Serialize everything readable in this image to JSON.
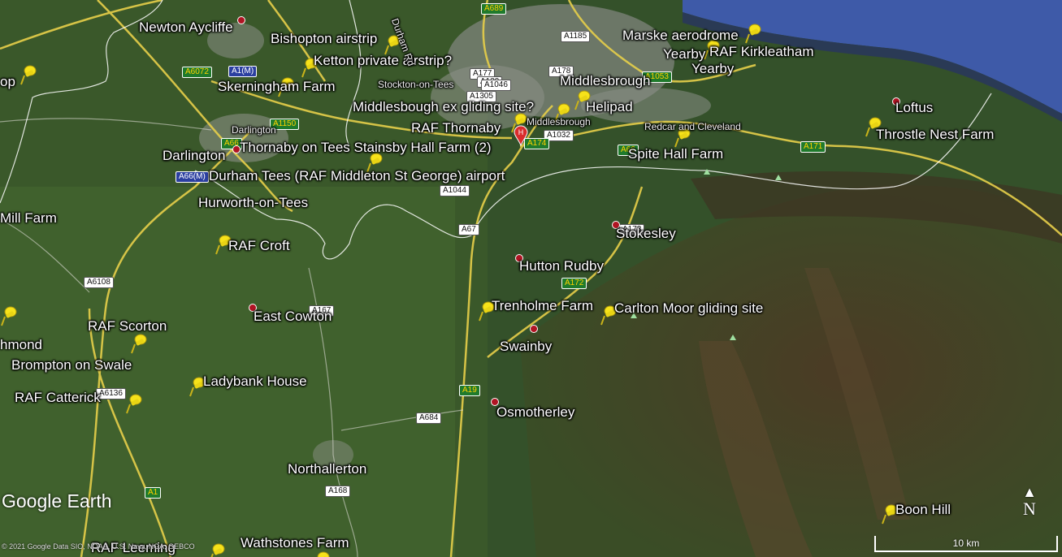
{
  "map": {
    "place_labels": [
      {
        "id": "newton-aycliffe",
        "text": "Newton Aycliffe"
      },
      {
        "id": "bishopton-airstrip",
        "text": "Bishopton airstrip"
      },
      {
        "id": "ketton-private-airstrip",
        "text": "Ketton private airstrip?"
      },
      {
        "id": "skerningham-farm",
        "text": "Skerningham Farm"
      },
      {
        "id": "stockton-on-tees",
        "text": "Stockton-on-Tees"
      },
      {
        "id": "middlesbrough",
        "text": "Middlesbrough"
      },
      {
        "id": "marske-aerodrome",
        "text": "Marske aerodrome"
      },
      {
        "id": "yearby-1",
        "text": "Yearby"
      },
      {
        "id": "raf-kirkleatham",
        "text": "RAF Kirkleatham"
      },
      {
        "id": "yearby-2",
        "text": "Yearby"
      },
      {
        "id": "middlesbough-ex-gliding-site",
        "text": "Middlesbough ex gliding site?"
      },
      {
        "id": "helipad",
        "text": "Helipad"
      },
      {
        "id": "loftus",
        "text": "Loftus"
      },
      {
        "id": "throstle-nest-farm",
        "text": "Throstle Nest Farm"
      },
      {
        "id": "raf-thornaby",
        "text": "RAF Thornaby"
      },
      {
        "id": "middlesbrough-small",
        "text": "Middlesbrough"
      },
      {
        "id": "darlington-small",
        "text": "Darlington"
      },
      {
        "id": "redcar-and-cleveland",
        "text": "Redcar and Cleveland"
      },
      {
        "id": "darlington",
        "text": "Darlington"
      },
      {
        "id": "thornaby-stainsby",
        "text": "Thornaby on Tees Stainsby Hall Farm (2)"
      },
      {
        "id": "spite-hall-farm",
        "text": "Spite Hall Farm"
      },
      {
        "id": "durham-tees-airport",
        "text": "Durham Tees (RAF Middleton St George) airport"
      },
      {
        "id": "hurworth-on-tees",
        "text": "Hurworth-on-Tees"
      },
      {
        "id": "mill-farm",
        "text": "Mill Farm"
      },
      {
        "id": "stokesley",
        "text": "Stokesley"
      },
      {
        "id": "raf-croft",
        "text": "RAF Croft"
      },
      {
        "id": "hutton-rudby",
        "text": "Hutton Rudby"
      },
      {
        "id": "trenholme-farm",
        "text": "Trenholme Farm"
      },
      {
        "id": "carlton-moor-gliding-site",
        "text": "Carlton Moor gliding site"
      },
      {
        "id": "east-cowton",
        "text": "East Cowton"
      },
      {
        "id": "raf-scorton",
        "text": "RAF Scorton"
      },
      {
        "id": "richmond",
        "text": "hmond"
      },
      {
        "id": "swainby",
        "text": "Swainby"
      },
      {
        "id": "brompton-on-swale",
        "text": "Brompton on Swale"
      },
      {
        "id": "ladybank-house",
        "text": "Ladybank House"
      },
      {
        "id": "raf-catterick",
        "text": "RAF Catterick"
      },
      {
        "id": "osmotherley",
        "text": "Osmotherley"
      },
      {
        "id": "northallerton",
        "text": "Northallerton"
      },
      {
        "id": "boon-hill",
        "text": "Boon Hill"
      },
      {
        "id": "raf-leeming",
        "text": "RAF Leeming"
      },
      {
        "id": "wathstones-farm",
        "text": "Wathstones Farm"
      },
      {
        "id": "op",
        "text": "op"
      },
      {
        "id": "durham-rd",
        "text": "Durham Rd"
      }
    ],
    "road_shields": [
      {
        "id": "a689",
        "text": "A689",
        "style": "pri"
      },
      {
        "id": "a1185",
        "text": "A1185",
        "style": "a"
      },
      {
        "id": "a1m",
        "text": "A1(M)",
        "style": "m"
      },
      {
        "id": "a6072",
        "text": "A6072",
        "style": "pri"
      },
      {
        "id": "a177",
        "text": "A177",
        "style": "a"
      },
      {
        "id": "a178",
        "text": "A178",
        "style": "a"
      },
      {
        "id": "a139",
        "text": "A139",
        "style": "a"
      },
      {
        "id": "a1046",
        "text": "A1046",
        "style": "a"
      },
      {
        "id": "a1053",
        "text": "A1053",
        "style": "pri"
      },
      {
        "id": "a1305",
        "text": "A1305",
        "style": "a"
      },
      {
        "id": "a1150",
        "text": "A1150",
        "style": "pri"
      },
      {
        "id": "a1032",
        "text": "A1032",
        "style": "a"
      },
      {
        "id": "a174",
        "text": "A174",
        "style": "pri"
      },
      {
        "id": "a171",
        "text": "A171",
        "style": "pri"
      },
      {
        "id": "a66m",
        "text": "A66(M)",
        "style": "m"
      },
      {
        "id": "a1044",
        "text": "A1044",
        "style": "a"
      },
      {
        "id": "a67",
        "text": "A67",
        "style": "a"
      },
      {
        "id": "a173",
        "text": "A173",
        "style": "a"
      },
      {
        "id": "a172",
        "text": "A172",
        "style": "pri"
      },
      {
        "id": "a6108",
        "text": "A6108",
        "style": "a"
      },
      {
        "id": "a167",
        "text": "A167",
        "style": "a"
      },
      {
        "id": "a6136",
        "text": "A6136",
        "style": "a"
      },
      {
        "id": "a19",
        "text": "A19",
        "style": "pri"
      },
      {
        "id": "a684",
        "text": "A684",
        "style": "a"
      },
      {
        "id": "a168",
        "text": "A168",
        "style": "a"
      },
      {
        "id": "a1",
        "text": "A1",
        "style": "pri"
      },
      {
        "id": "a66-left",
        "text": "A66",
        "style": "pri"
      },
      {
        "id": "a66-right",
        "text": "A66",
        "style": "pri"
      }
    ],
    "pin_count_note": "",
    "logo": "Google Earth",
    "copyright": "Data SIO, NOAA, U.S. Navy, NGA, GEBCO",
    "copyright_year": "© 2021 Google",
    "scale_label": "10 km",
    "north_label": "N",
    "colors": {
      "sea": "#3e5aa8",
      "land_dark": "#2c4520",
      "land_light": "#4f7a34",
      "urban": "#8a8f86",
      "moor": "#4a3a26",
      "road_major": "#e7cf4a",
      "boundary": "#ffffff",
      "pin": "#f6e21a",
      "dot": "#b01423"
    }
  }
}
